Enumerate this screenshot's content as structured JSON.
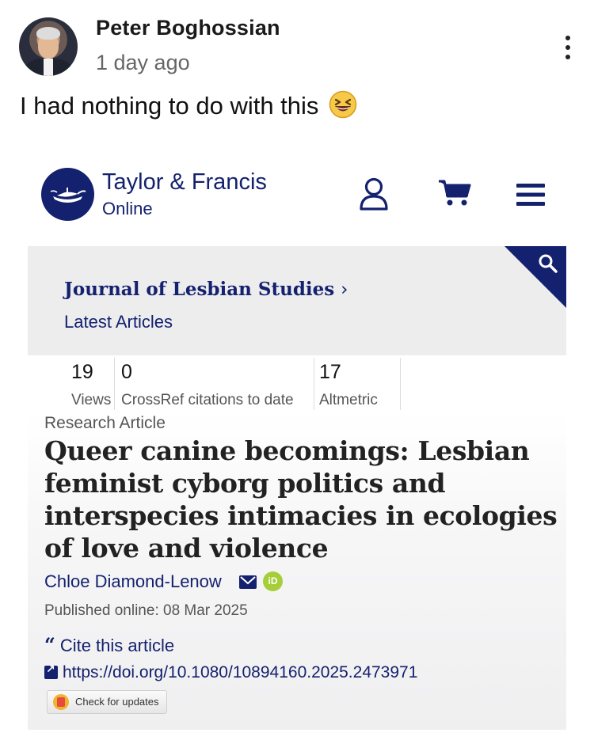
{
  "post": {
    "author": "Peter Boghossian",
    "time": "1 day ago",
    "text": "I had nothing to do with this",
    "emoji": "grinning-squinting-face-emoji"
  },
  "publisher": {
    "brand_line1": "Taylor & Francis",
    "brand_line2": "Online",
    "color": "#14216e"
  },
  "journal": {
    "name": "Journal of Lesbian Studies",
    "chevron": "›",
    "subtitle": "Latest Articles"
  },
  "metrics": [
    {
      "value": "19",
      "label": "Views"
    },
    {
      "value": "0",
      "label": "CrossRef citations to date"
    },
    {
      "value": "17",
      "label": "Altmetric"
    }
  ],
  "article": {
    "type": "Research Article",
    "title": "Queer canine becomings: Lesbian feminist cyborg politics and interspecies intimacies in ecologies of love and violence",
    "author": "Chloe Diamond-Lenow",
    "published": "Published online: 08 Mar 2025",
    "cite_label": "Cite this article",
    "doi": "https://doi.org/10.1080/10894160.2025.2473971",
    "check_updates": "Check for updates"
  },
  "icons": {
    "more": "more-vertical-icon",
    "user": "user-icon",
    "cart": "cart-icon",
    "menu": "menu-icon",
    "search": "search-icon",
    "email": "email-icon",
    "orcid": "orcid-icon",
    "cite": "quote-icon",
    "doi": "external-link-icon"
  }
}
